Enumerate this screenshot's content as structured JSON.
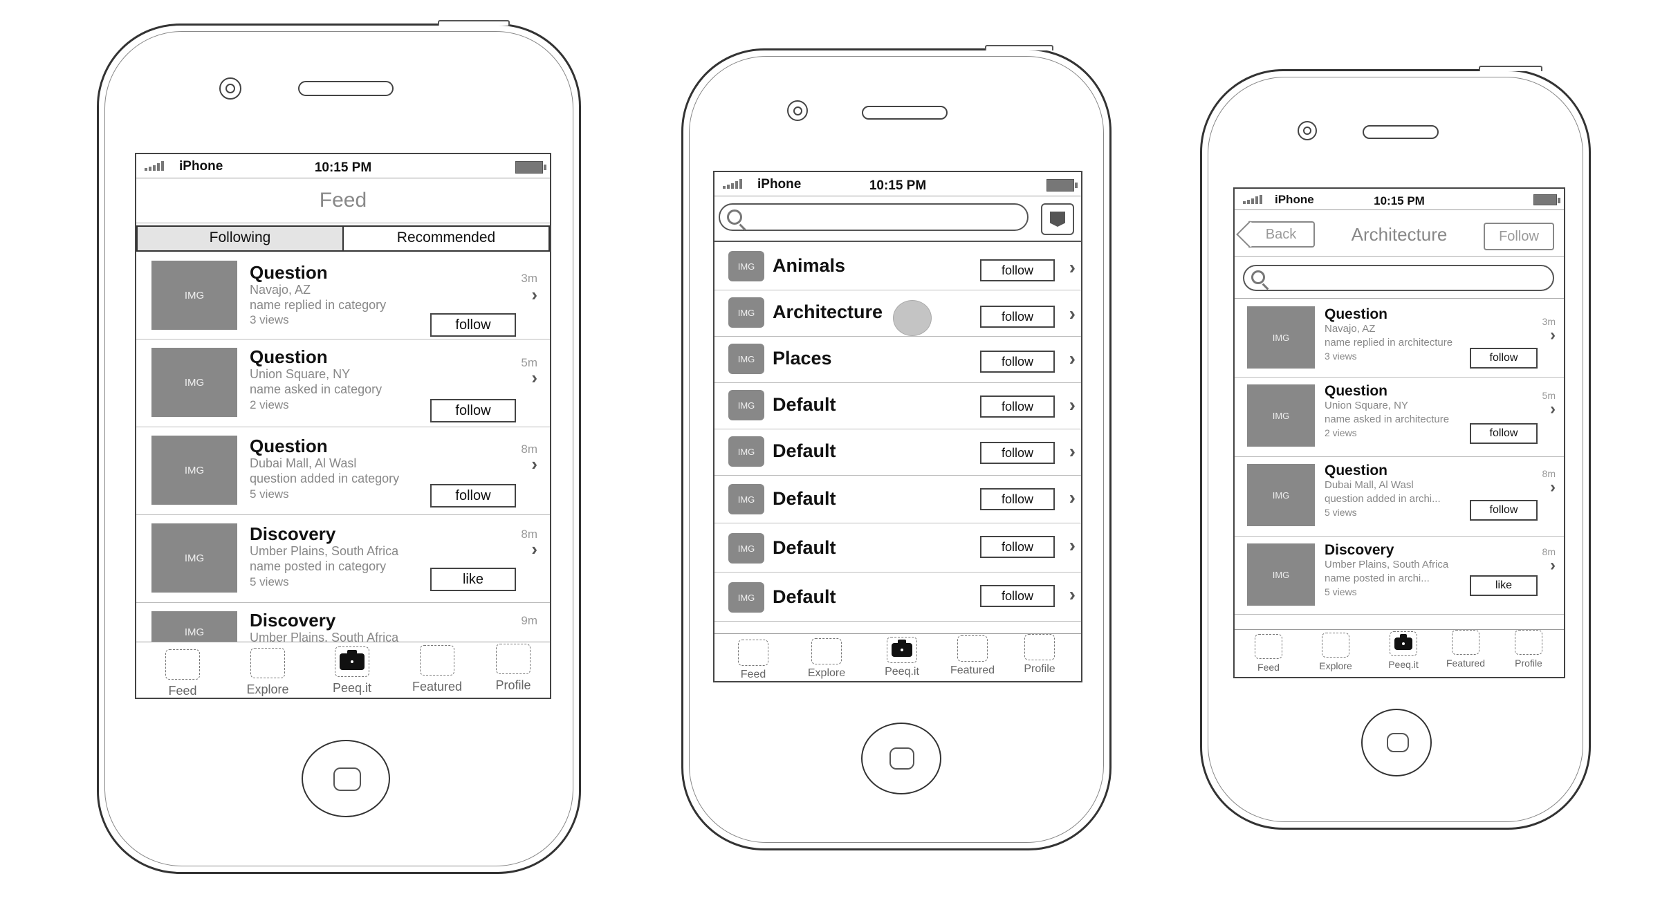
{
  "status": {
    "carrier": "iPhone",
    "time": "10:15 PM"
  },
  "tabs": [
    {
      "label": "Feed",
      "icon": "feed-tab-icon"
    },
    {
      "label": "Explore",
      "icon": "explore-tab-icon"
    },
    {
      "label": "Peeq.it",
      "icon": "camera-icon"
    },
    {
      "label": "Featured",
      "icon": "featured-tab-icon"
    },
    {
      "label": "Profile",
      "icon": "profile-tab-icon"
    }
  ],
  "img_placeholder": "IMG",
  "phone1": {
    "title": "Feed",
    "segments": [
      "Following",
      "Recommended"
    ],
    "items": [
      {
        "title": "Question",
        "location": "Navajo, AZ",
        "action": "name replied in category",
        "views": "3 views",
        "time": "3m",
        "button": "follow"
      },
      {
        "title": "Question",
        "location": "Union Square, NY",
        "action": "name asked in category",
        "views": "2 views",
        "time": "5m",
        "button": "follow"
      },
      {
        "title": "Question",
        "location": "Dubai Mall, Al Wasl",
        "action": "question added in category",
        "views": "5 views",
        "time": "8m",
        "button": "follow"
      },
      {
        "title": "Discovery",
        "location": "Umber Plains, South Africa",
        "action": "name posted in category",
        "views": "5 views",
        "time": "8m",
        "button": "like"
      },
      {
        "title": "Discovery",
        "location": "Umber Plains, South Africa",
        "time": "9m"
      }
    ]
  },
  "phone2": {
    "search_placeholder": "",
    "categories": [
      {
        "name": "Animals",
        "button": "follow"
      },
      {
        "name": "Architecture",
        "button": "follow"
      },
      {
        "name": "Places",
        "button": "follow"
      },
      {
        "name": "Default",
        "button": "follow"
      },
      {
        "name": "Default",
        "button": "follow"
      },
      {
        "name": "Default",
        "button": "follow"
      },
      {
        "name": "Default",
        "button": "follow"
      },
      {
        "name": "Default",
        "button": "follow"
      }
    ]
  },
  "phone3": {
    "back": "Back",
    "title": "Architecture",
    "follow": "Follow",
    "search_placeholder": "",
    "items": [
      {
        "title": "Question",
        "location": "Navajo, AZ",
        "action": "name replied in architecture",
        "views": "3 views",
        "time": "3m",
        "button": "follow"
      },
      {
        "title": "Question",
        "location": "Union Square, NY",
        "action": "name asked in architecture",
        "views": "2 views",
        "time": "5m",
        "button": "follow"
      },
      {
        "title": "Question",
        "location": "Dubai Mall, Al Wasl",
        "action": "question added in archi...",
        "views": "5 views",
        "time": "8m",
        "button": "follow"
      },
      {
        "title": "Discovery",
        "location": "Umber Plains, South Africa",
        "action": "name posted in archi...",
        "views": "5 views",
        "time": "8m",
        "button": "like"
      }
    ]
  }
}
